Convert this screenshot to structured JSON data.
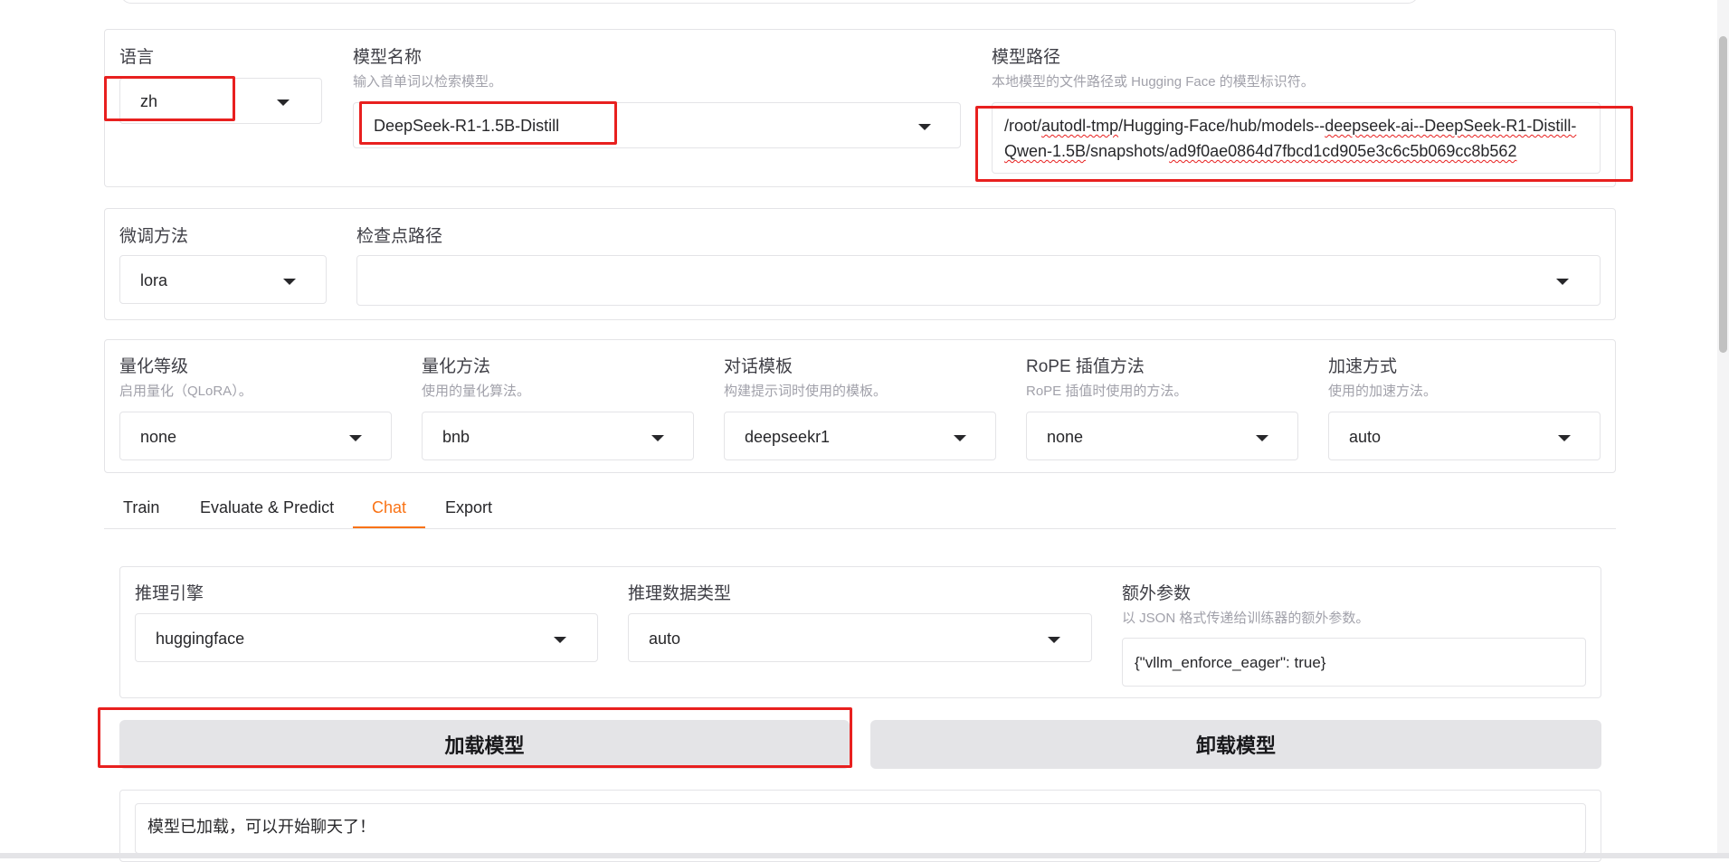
{
  "model_row": {
    "lang_label": "语言",
    "lang_value": "zh",
    "name_label": "模型名称",
    "name_info": "输入首单词以检索模型。",
    "name_value": "DeepSeek-R1-1.5B-Distill",
    "path_label": "模型路径",
    "path_info": "本地模型的文件路径或 Hugging Face 的模型标识符。",
    "path_line1_a": "/root/",
    "path_line1_b": "autodl-tmp",
    "path_line1_c": "/Hugging-Face/hub/models--",
    "path_line1_d": "deepseek-ai--DeepSeek-R1-Distill-",
    "path_line2_a": "Qwen-1.5B",
    "path_line2_b": "/snapshots/",
    "path_line2_c": "ad9f0ae0864d7fbcd1cd905e3c6c5b069cc8b562"
  },
  "finetune_row": {
    "method_label": "微调方法",
    "method_value": "lora",
    "ckpt_label": "检查点路径",
    "ckpt_value": ""
  },
  "quant_row": {
    "items": [
      {
        "label": "量化等级",
        "info": "启用量化（QLoRA）。",
        "value": "none"
      },
      {
        "label": "量化方法",
        "info": "使用的量化算法。",
        "value": "bnb"
      },
      {
        "label": "对话模板",
        "info": "构建提示词时使用的模板。",
        "value": "deepseekr1"
      },
      {
        "label": "RoPE 插值方法",
        "info": "RoPE 插值时使用的方法。",
        "value": "none"
      },
      {
        "label": "加速方式",
        "info": "使用的加速方法。",
        "value": "auto"
      }
    ]
  },
  "tabs": [
    "Train",
    "Evaluate & Predict",
    "Chat",
    "Export"
  ],
  "active_tab": "Chat",
  "chat": {
    "engine_label": "推理引擎",
    "engine_value": "huggingface",
    "dtype_label": "推理数据类型",
    "dtype_value": "auto",
    "extra_label": "额外参数",
    "extra_info": "以 JSON 格式传递给训练器的额外参数。",
    "extra_value": "{\"vllm_enforce_eager\": true}",
    "load_button": "加载模型",
    "unload_button": "卸载模型",
    "status_text": "模型已加载，可以开始聊天了！"
  },
  "colors": {
    "accent": "#f97316",
    "highlight": "#e8201f",
    "button_bg": "#e4e4e7"
  }
}
